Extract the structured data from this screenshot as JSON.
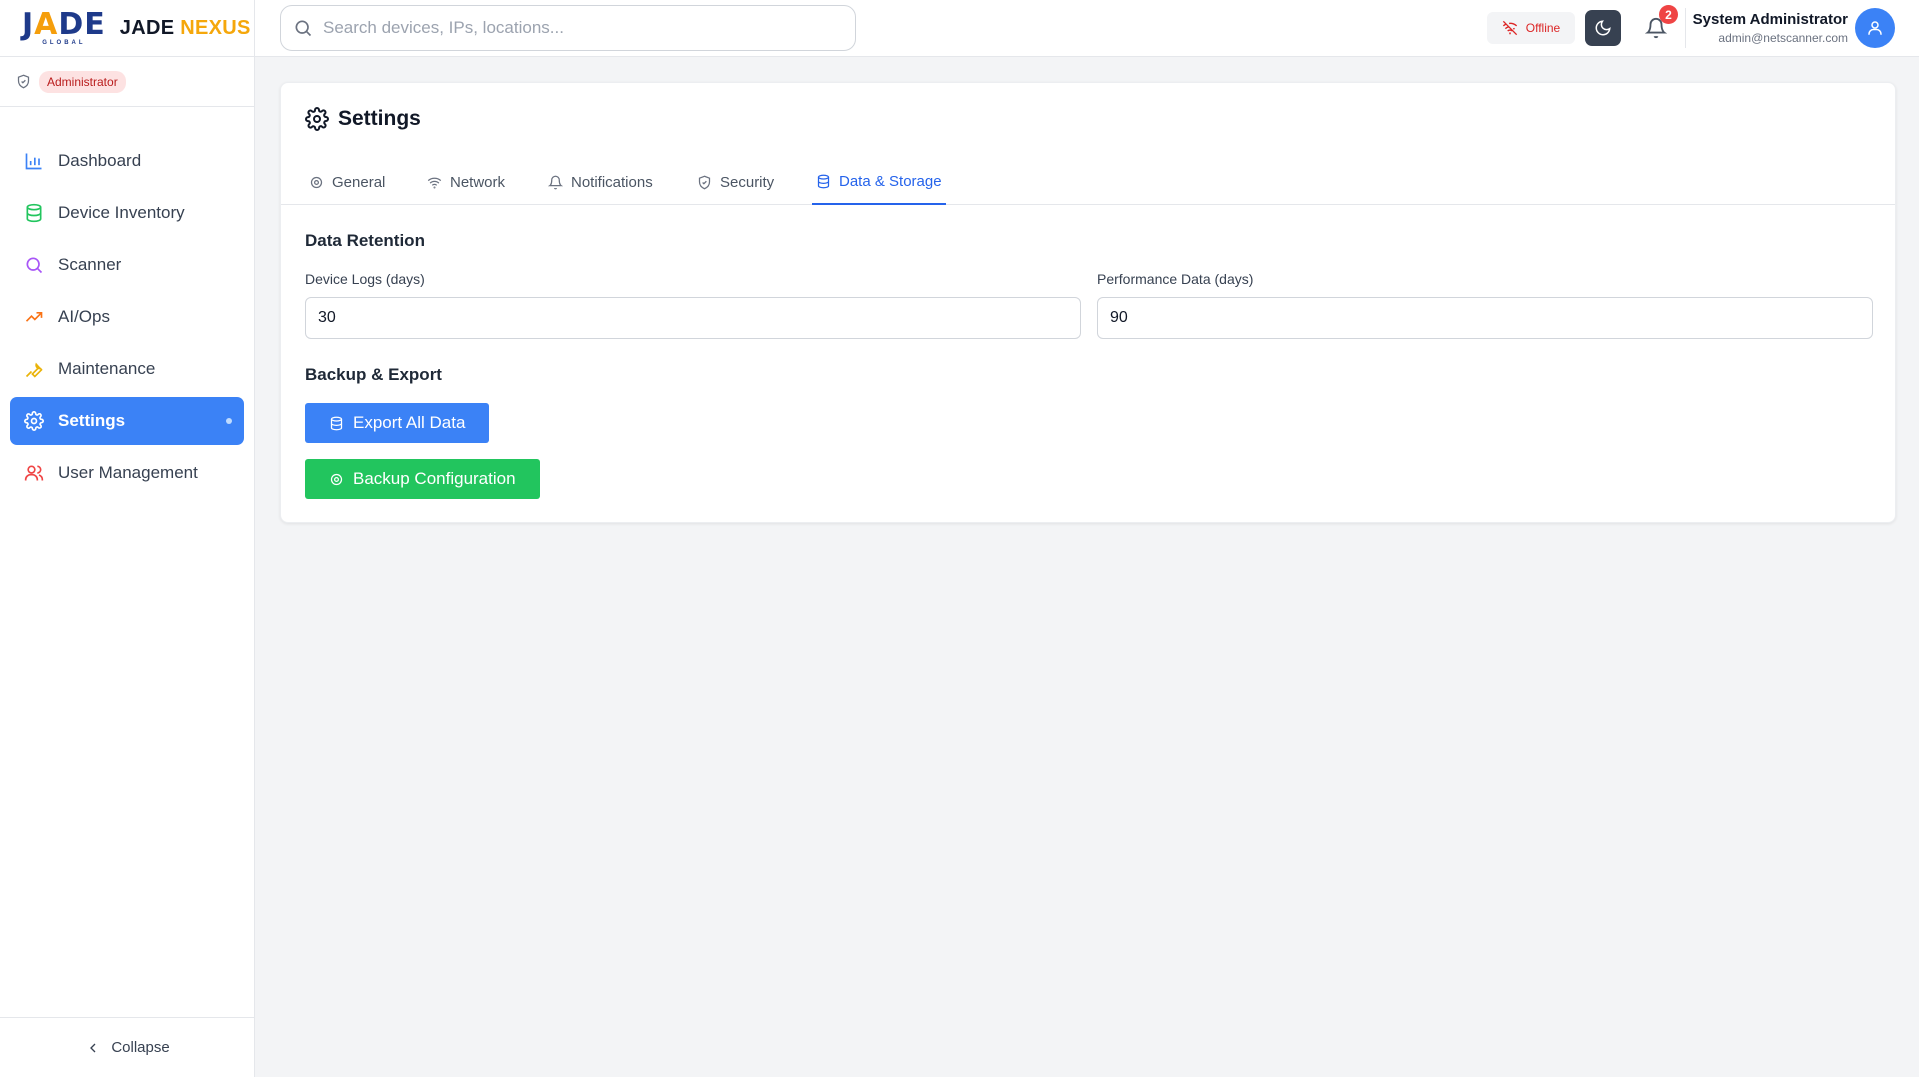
{
  "brand": {
    "logo_text": "JADE",
    "logo_sub": "GLOBAL",
    "name_part1": "JADE",
    "name_part2": "NEXUS"
  },
  "role": {
    "label": "Administrator"
  },
  "nav": {
    "items": [
      {
        "label": "Dashboard",
        "icon": "bar-chart-icon",
        "color": "#3b82f6"
      },
      {
        "label": "Device Inventory",
        "icon": "database-icon",
        "color": "#22c55e"
      },
      {
        "label": "Scanner",
        "icon": "search-icon",
        "color": "#a855f7"
      },
      {
        "label": "AI/Ops",
        "icon": "trending-up-icon",
        "color": "#f97316"
      },
      {
        "label": "Maintenance",
        "icon": "wrench-icon",
        "color": "#eab308"
      },
      {
        "label": "Settings",
        "icon": "gear-icon",
        "color": "#ffffff",
        "active": true
      },
      {
        "label": "User Management",
        "icon": "users-icon",
        "color": "#ef4444"
      }
    ],
    "collapse_label": "Collapse"
  },
  "topbar": {
    "search_placeholder": "Search devices, IPs, locations...",
    "status_label": "Offline",
    "notification_count": "2",
    "user_name": "System Administrator",
    "user_email": "admin@netscanner.com"
  },
  "settings": {
    "title": "Settings",
    "tabs": [
      {
        "label": "General",
        "icon": "gear-icon"
      },
      {
        "label": "Network",
        "icon": "wifi-icon"
      },
      {
        "label": "Notifications",
        "icon": "bell-icon"
      },
      {
        "label": "Security",
        "icon": "shield-icon"
      },
      {
        "label": "Data & Storage",
        "icon": "database-icon",
        "active": true
      }
    ],
    "data_retention": {
      "title": "Data Retention",
      "device_logs_label": "Device Logs (days)",
      "device_logs_value": "30",
      "performance_label": "Performance Data (days)",
      "performance_value": "90"
    },
    "backup": {
      "title": "Backup & Export",
      "export_label": "Export All Data",
      "backup_label": "Backup Configuration"
    }
  },
  "colors": {
    "accent": "#3b82f6",
    "success": "#22c55e",
    "danger": "#ef4444",
    "brand_yellow": "#f5a70b"
  }
}
